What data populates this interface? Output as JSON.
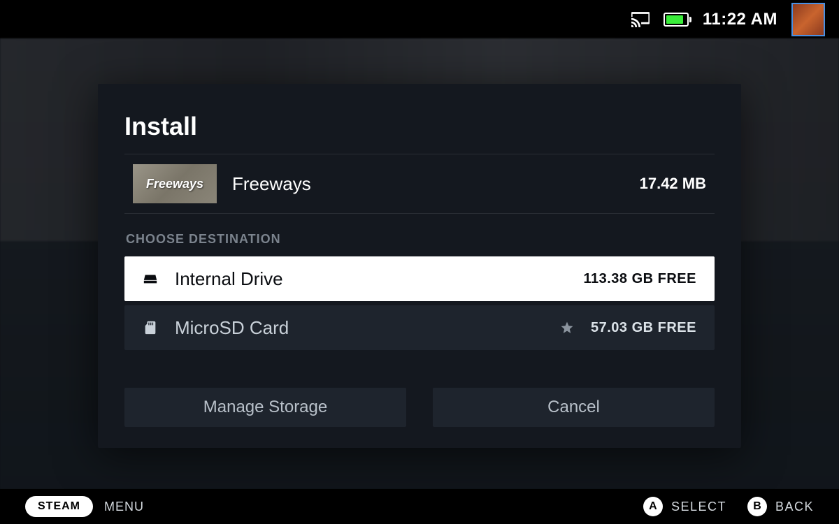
{
  "topbar": {
    "clock": "11:22 AM"
  },
  "dialog": {
    "title": "Install",
    "game": {
      "name": "Freeways",
      "thumb_label": "Freeways",
      "size": "17.42 MB"
    },
    "section_label": "CHOOSE DESTINATION",
    "destinations": [
      {
        "name": "Internal Drive",
        "free": "113.38 GB FREE",
        "selected": true,
        "starred": false
      },
      {
        "name": "MicroSD Card",
        "free": "57.03 GB FREE",
        "selected": false,
        "starred": true
      }
    ],
    "buttons": {
      "manage": "Manage Storage",
      "cancel": "Cancel"
    }
  },
  "bottombar": {
    "steam": "STEAM",
    "menu": "MENU",
    "hints": [
      {
        "btn": "A",
        "label": "SELECT"
      },
      {
        "btn": "B",
        "label": "BACK"
      }
    ]
  }
}
